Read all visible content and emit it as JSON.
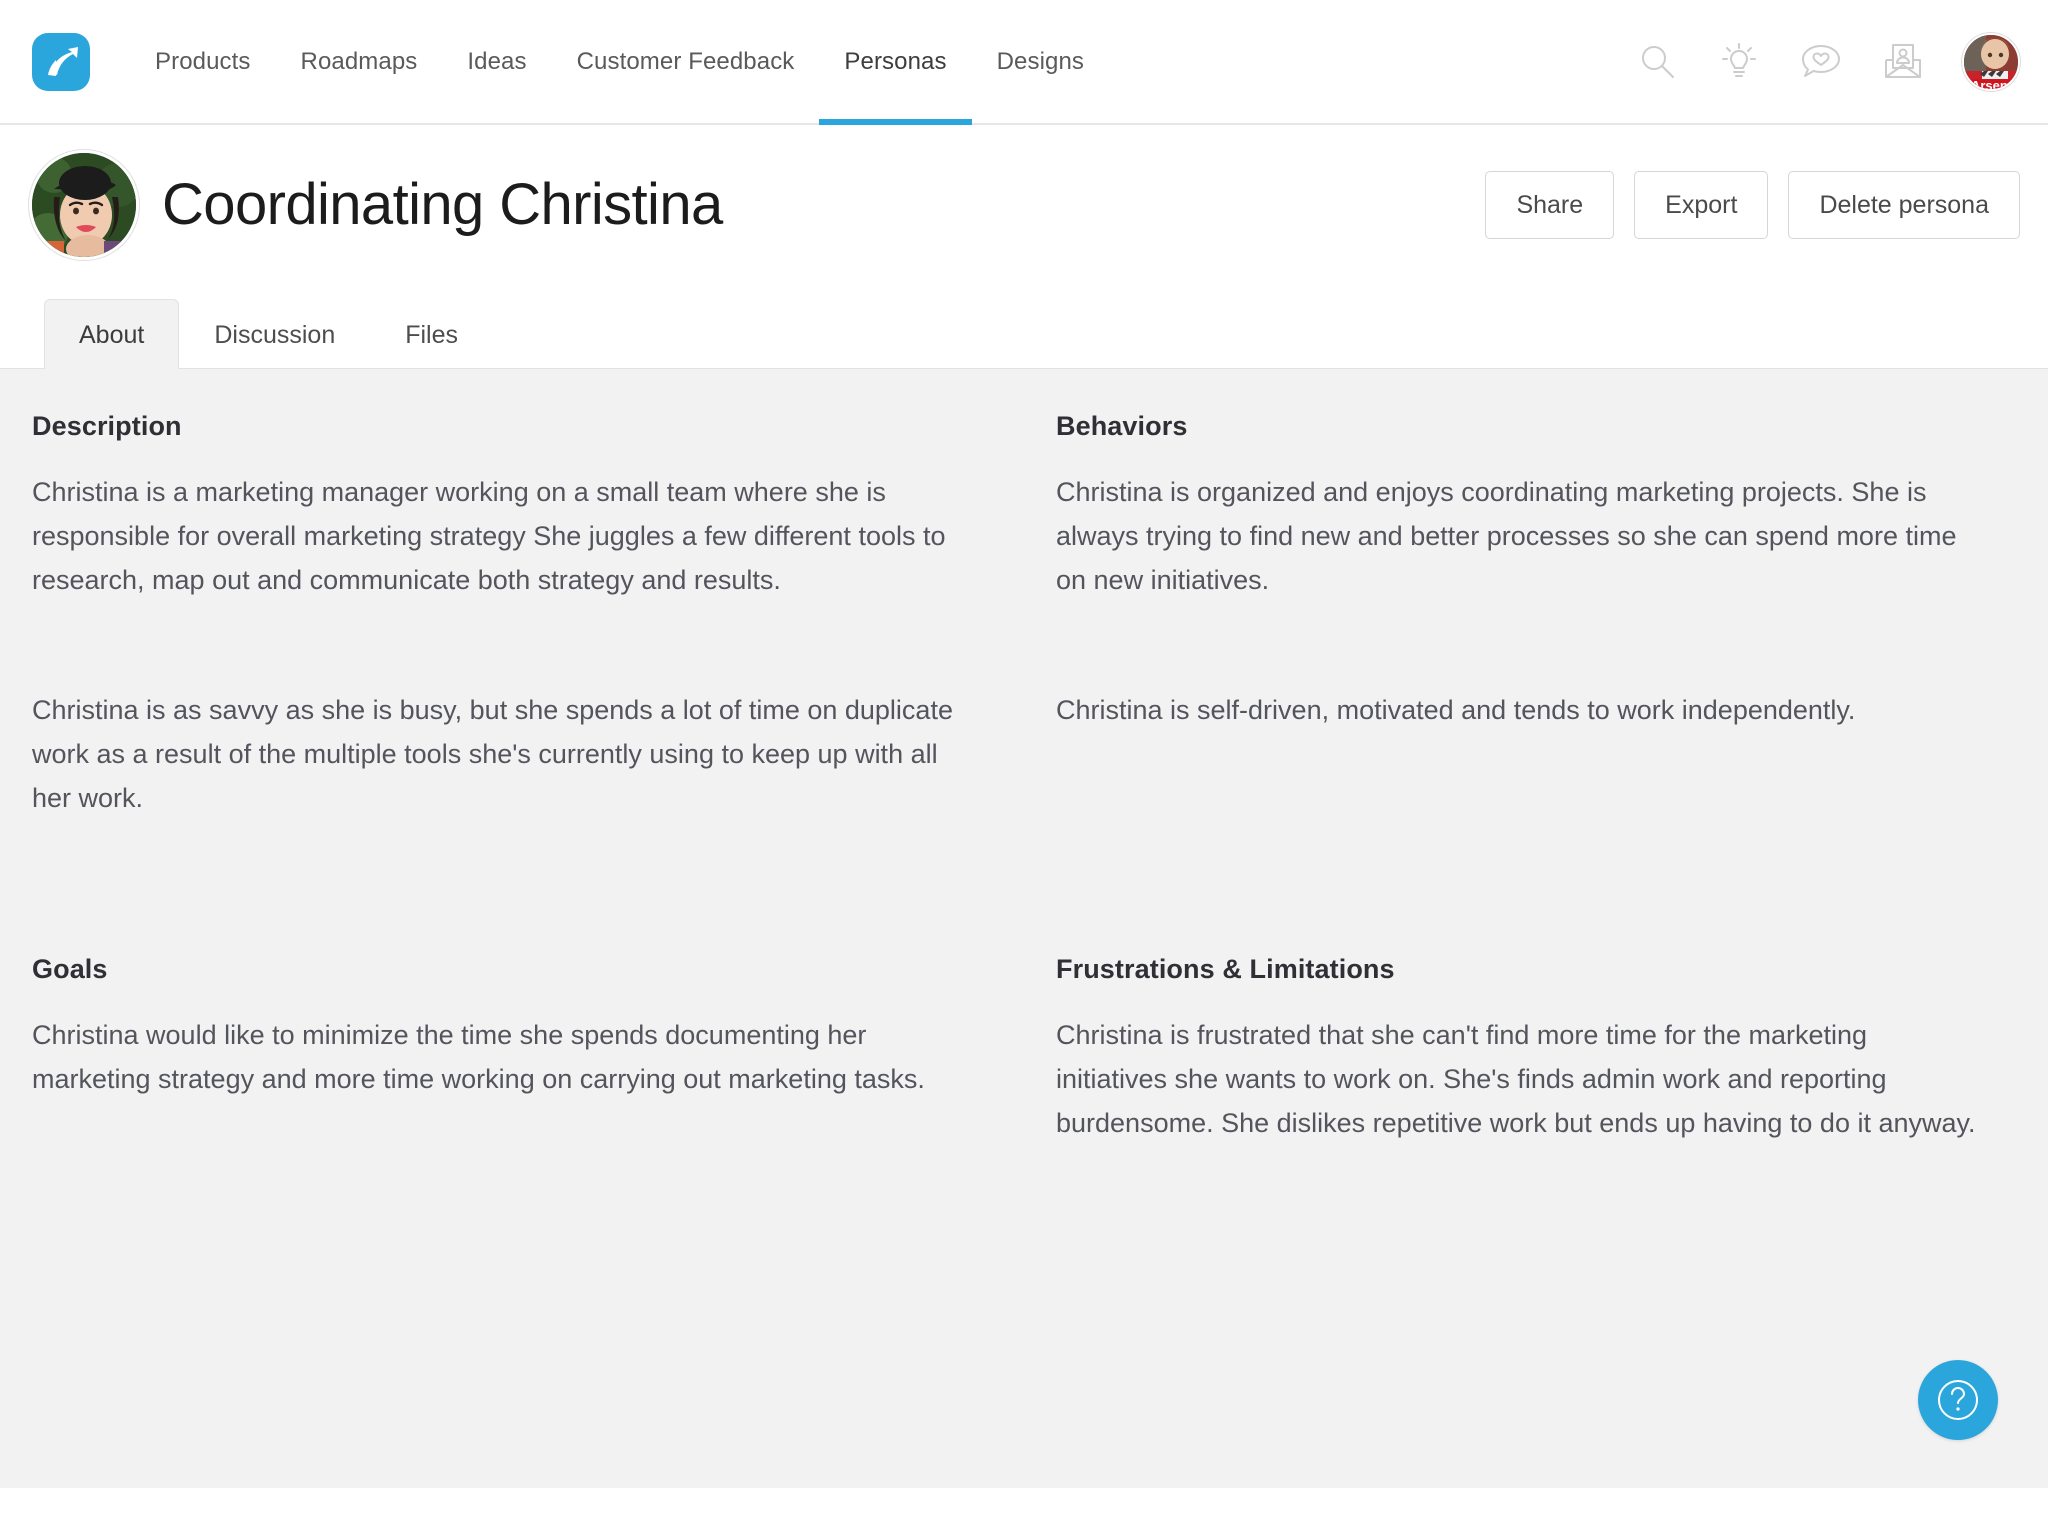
{
  "nav": {
    "logo_icon": "aha-arrow-logo",
    "brand_color": "#2ba6dc",
    "items": [
      {
        "label": "Products",
        "active": false
      },
      {
        "label": "Roadmaps",
        "active": false
      },
      {
        "label": "Ideas",
        "active": false
      },
      {
        "label": "Customer Feedback",
        "active": false
      },
      {
        "label": "Personas",
        "active": true
      },
      {
        "label": "Designs",
        "active": false
      }
    ],
    "icons": [
      {
        "name": "search-icon"
      },
      {
        "name": "lightbulb-icon"
      },
      {
        "name": "heart-chat-icon"
      },
      {
        "name": "invite-envelope-icon"
      }
    ],
    "avatar": {
      "name": "user-avatar",
      "alt_text": "Arsenal"
    }
  },
  "persona": {
    "name": "Coordinating Christina",
    "avatar_name": "persona-avatar",
    "actions": [
      {
        "label": "Share",
        "name": "share-button"
      },
      {
        "label": "Export",
        "name": "export-button"
      },
      {
        "label": "Delete persona",
        "name": "delete-persona-button"
      }
    ]
  },
  "tabs": [
    {
      "label": "About",
      "active": true
    },
    {
      "label": "Discussion",
      "active": false
    },
    {
      "label": "Files",
      "active": false
    }
  ],
  "sections": {
    "description": {
      "title": "Description",
      "paragraph_1": "Christina is a marketing manager working on a small team where she is responsible for overall marketing strategy She juggles a few different tools to research, map out and communicate both strategy and results.",
      "paragraph_2": "Christina is as savvy as she is busy, but she spends a lot of time on duplicate work as a result of the multiple tools she's currently using to keep up with all her work."
    },
    "goals": {
      "title": "Goals",
      "paragraph_1": "Christina would like to minimize the time she spends documenting her marketing strategy and more time working on carrying out marketing tasks."
    },
    "behaviors": {
      "title": "Behaviors",
      "paragraph_1": "Christina is organized and enjoys coordinating marketing projects. She is always trying to find new and better processes so she can spend more time on new initiatives.",
      "paragraph_2": "Christina is self-driven, motivated and tends to work independently."
    },
    "frustrations": {
      "title": "Frustrations & Limitations",
      "paragraph_1": "Christina is frustrated that she can't find more time for the marketing initiatives she wants to work on. She's finds admin work and reporting burdensome. She dislikes repetitive work but ends up having to do it anyway."
    }
  },
  "help": {
    "name": "help-button",
    "icon": "question-mark-icon",
    "color": "#2ba6dc"
  }
}
